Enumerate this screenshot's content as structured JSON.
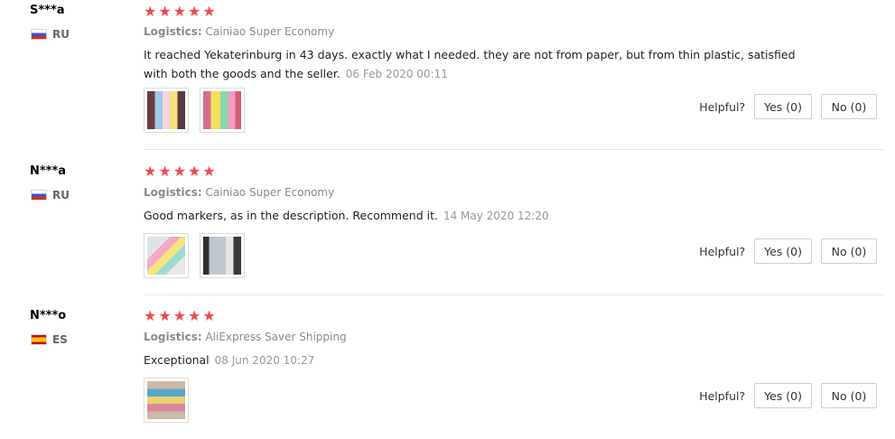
{
  "reviews": [
    {
      "user": "S***a",
      "country": "RU",
      "rating": 5,
      "logistics_label": "Logistics:",
      "logistics_value": "Cainiao Super Economy",
      "comment": "It reached Yekaterinburg in 43 days. exactly what I needed. they are not from paper, but from thin plastic, satisfied with both the goods and the seller.",
      "date": "06 Feb 2020 00:11",
      "helpful_label": "Helpful?",
      "yes_label": "Yes (0)",
      "no_label": "No (0)",
      "photos": 2
    },
    {
      "user": "N***a",
      "country": "RU",
      "rating": 5,
      "logistics_label": "Logistics:",
      "logistics_value": "Cainiao Super Economy",
      "comment": "Good markers, as in the description. Recommend it.",
      "date": "14 May 2020 12:20",
      "helpful_label": "Helpful?",
      "yes_label": "Yes (0)",
      "no_label": "No (0)",
      "photos": 2
    },
    {
      "user": "N***o",
      "country": "ES",
      "rating": 5,
      "logistics_label": "Logistics:",
      "logistics_value": "AliExpress Saver Shipping",
      "comment": "Exceptional",
      "date": "08 Jun 2020 10:27",
      "helpful_label": "Helpful?",
      "yes_label": "Yes (0)",
      "no_label": "No (0)",
      "photos": 1
    }
  ],
  "icons": {
    "star": "star-icon",
    "flag_ru": "russia-flag-icon",
    "flag_es": "spain-flag-icon"
  },
  "colors": {
    "star": "#ef4a4a"
  }
}
